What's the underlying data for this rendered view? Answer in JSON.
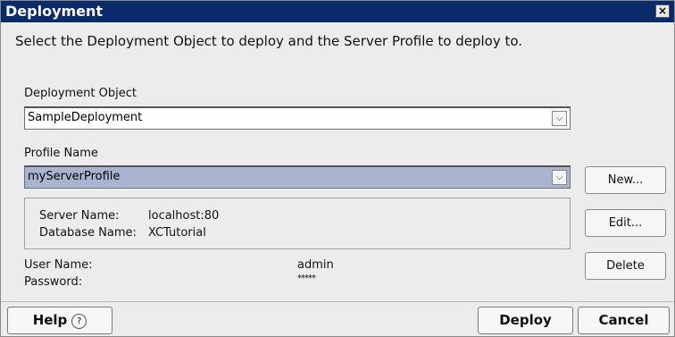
{
  "window": {
    "title": "Deployment",
    "close_glyph": "×"
  },
  "instruction": "Select the Deployment Object to deploy and the Server Profile to deploy to.",
  "deployment_object": {
    "label": "Deployment Object",
    "value": "SampleDeployment"
  },
  "profile": {
    "label": "Profile Name",
    "value": "myServerProfile"
  },
  "server_info": {
    "server_name_label": "Server Name:",
    "server_name_value": "localhost:80",
    "database_name_label": "Database Name:",
    "database_name_value": "XCTutorial"
  },
  "credentials": {
    "user_name_label": "User Name:",
    "user_name_value": "admin",
    "password_label": "Password:",
    "password_value": "*****"
  },
  "side_buttons": {
    "new": "New...",
    "edit": "Edit...",
    "delete": "Delete"
  },
  "footer": {
    "help": "Help",
    "help_icon": "?",
    "deploy": "Deploy",
    "cancel": "Cancel"
  },
  "colors": {
    "titlebar": "#0a2a6a",
    "selected_field": "#a8b4d0",
    "dialog_bg": "#ececec"
  },
  "icons": {
    "close": "close-icon",
    "dropdown": "chevron-down-icon",
    "help": "help-circle-icon"
  }
}
